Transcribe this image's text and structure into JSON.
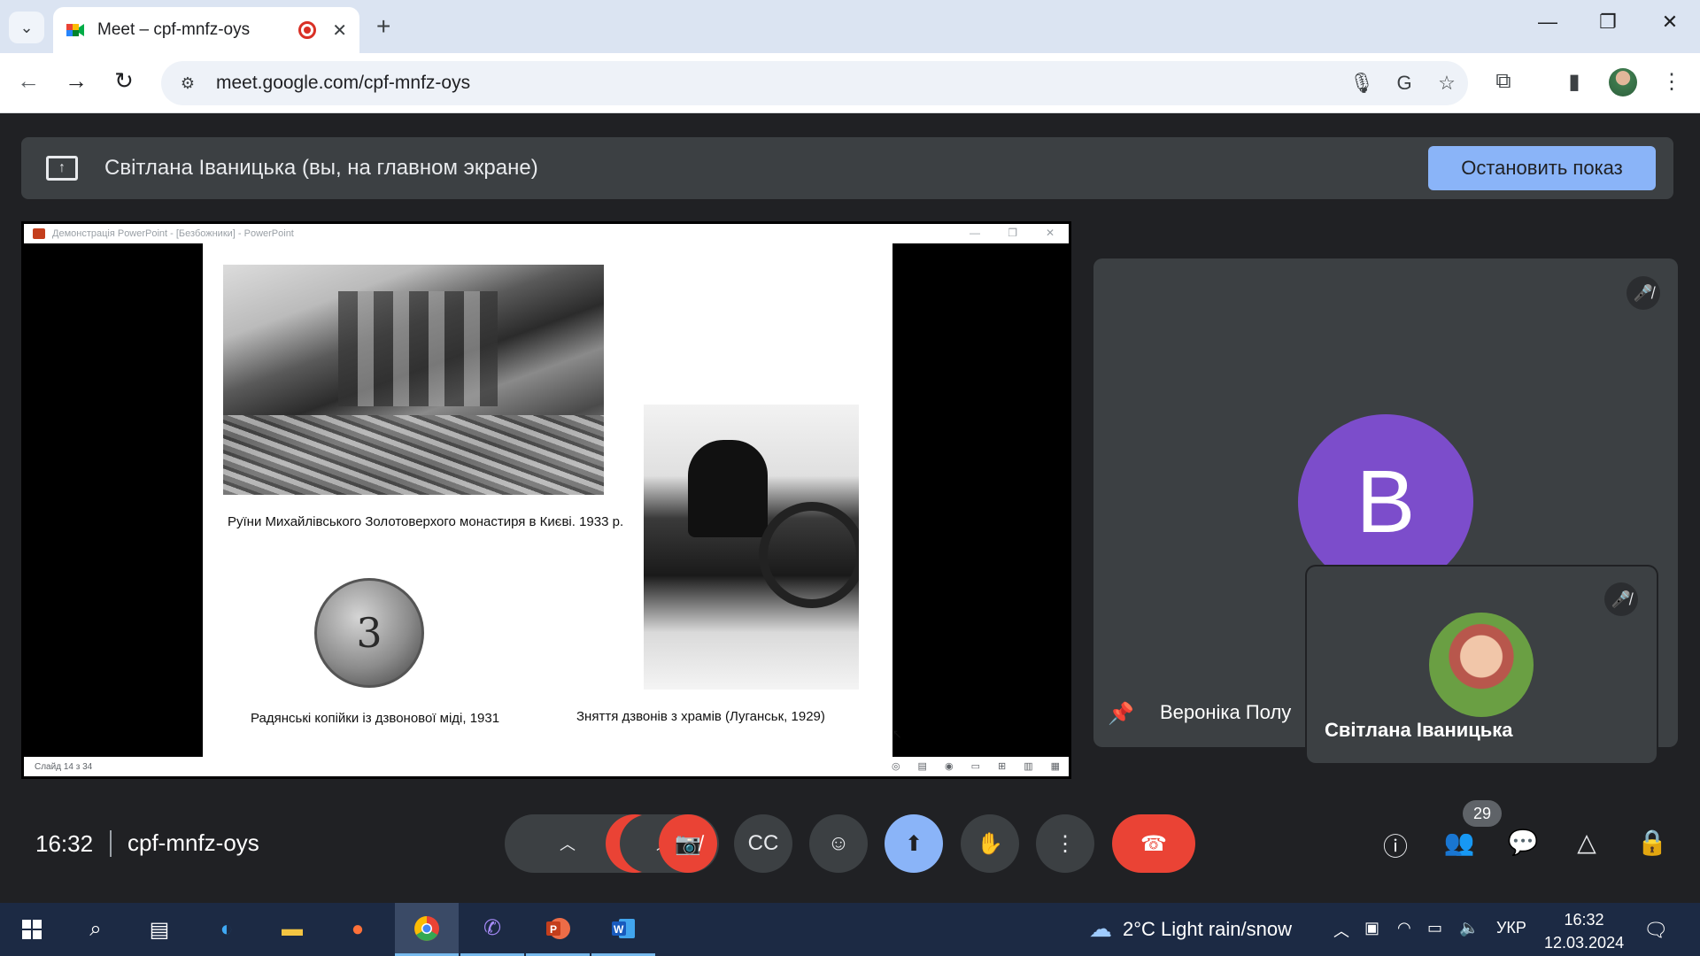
{
  "browser": {
    "tab_title": "Meet – cpf-mnfz-oys",
    "url": "meet.google.com/cpf-mnfz-oys"
  },
  "presenting": {
    "text": "Світлана Іваницька (вы, на главном экране)",
    "stop_label": "Остановить показ"
  },
  "shared_screen": {
    "window_title": "Демонстрація PowerPoint - [Безбожники] - PowerPoint",
    "status": "Слайд 14 з 34",
    "captions": {
      "ruins": "Руїни Михайлівського Золотоверхого монастиря в Києві. 1933 р.",
      "coins": "Радянські копійки із дзвонової міді, 1931",
      "bells": "Зняття дзвонів з храмів (Луганськ, 1929)"
    },
    "coin_digit": "3"
  },
  "participants": {
    "pinned": {
      "initial": "В",
      "name": "Вероніка Полу"
    },
    "self": {
      "name": "Світлана Іваницька"
    },
    "count": "29"
  },
  "meeting": {
    "time": "16:32",
    "code": "cpf-mnfz-oys"
  },
  "taskbar": {
    "weather": "2°C  Light rain/snow",
    "lang": "УКР",
    "time": "16:32",
    "date": "12.03.2024"
  },
  "colors": {
    "meet_bg": "#202124",
    "accent_blue": "#8ab4f8",
    "end_call_red": "#ea4335",
    "avatar_purple": "#7c4dcb"
  }
}
